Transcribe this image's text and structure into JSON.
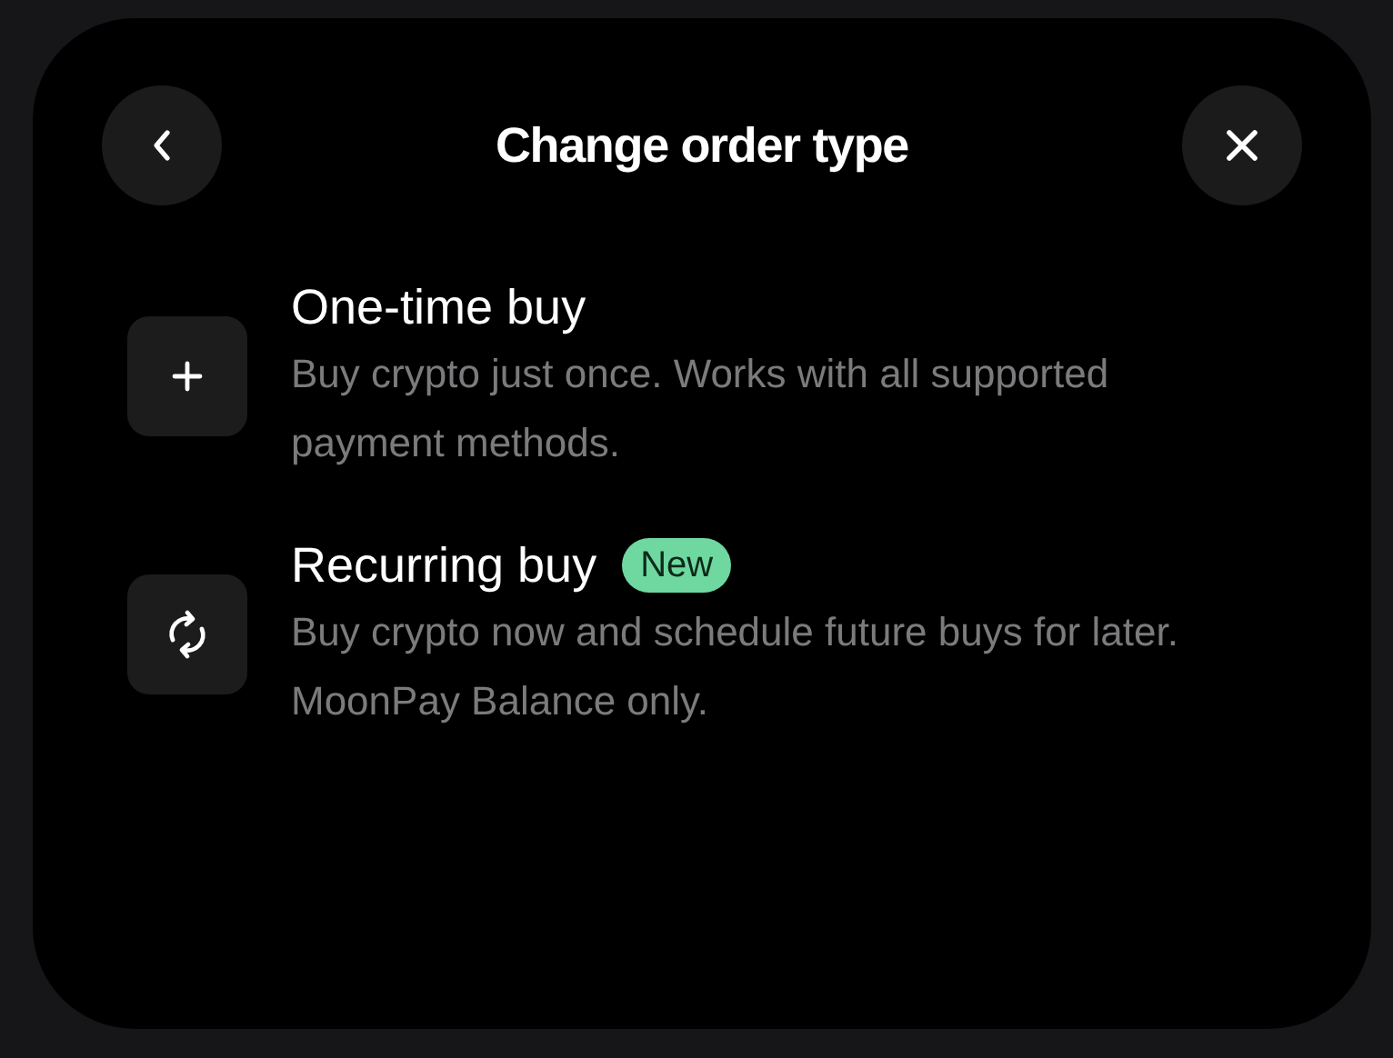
{
  "header": {
    "title": "Change order type"
  },
  "options": [
    {
      "kind": "one-time",
      "title": "One-time buy",
      "description": "Buy crypto just once. Works with all supported payment methods."
    },
    {
      "kind": "recurring",
      "title": "Recurring buy",
      "badge": "New",
      "description": "Buy crypto now and schedule future buys for later. MoonPay Balance only."
    }
  ]
}
